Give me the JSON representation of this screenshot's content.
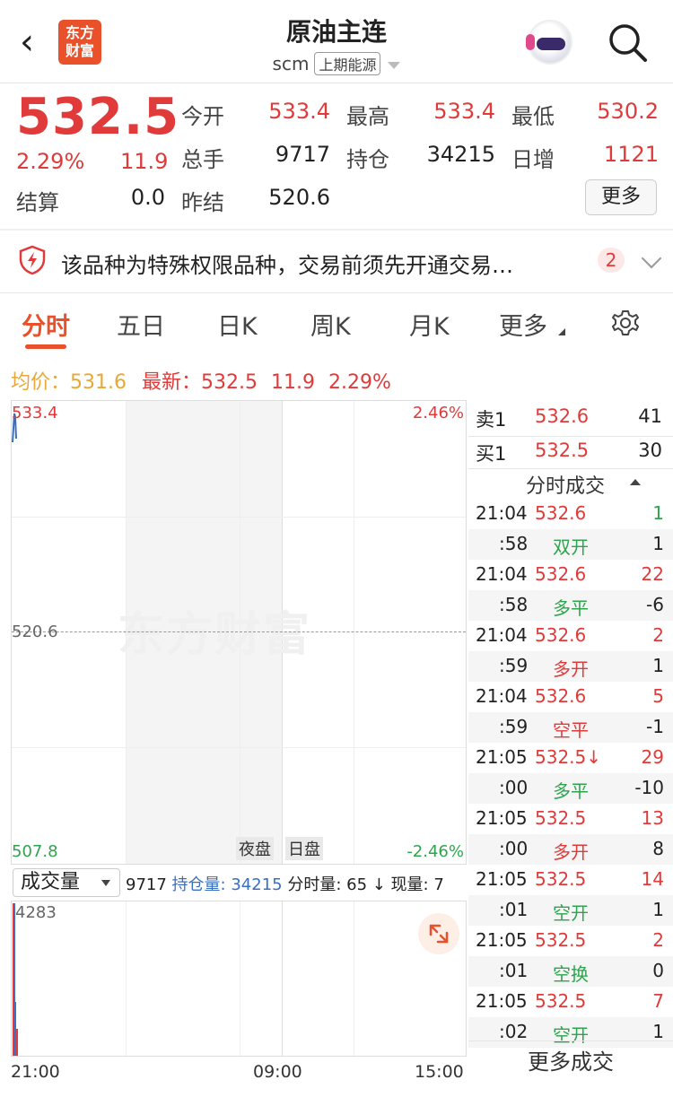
{
  "header": {
    "title": "原油主连",
    "code": "scm",
    "exchange": "上期能源",
    "logo_line1": "东方",
    "logo_line2": "财富"
  },
  "quote": {
    "price": "532.5",
    "change_pct": "2.29%",
    "change": "11.9",
    "open_label": "今开",
    "open": "533.4",
    "high_label": "最高",
    "high": "533.4",
    "low_label": "最低",
    "low": "530.2",
    "volume_label": "总手",
    "volume": "9717",
    "oi_label": "持仓",
    "oi": "34215",
    "daily_inc_label": "日增",
    "daily_inc": "1121",
    "settle_label": "结算",
    "settle": "0.0",
    "prev_settle_label": "昨结",
    "prev_settle": "520.6",
    "more_label": "更多"
  },
  "notice": {
    "text": "该品种为特殊权限品种，交易前须先开通交易…",
    "count": "2"
  },
  "tabs": [
    "分时",
    "五日",
    "日K",
    "周K",
    "月K",
    "更多"
  ],
  "info": {
    "avg_label": "均价：",
    "avg": "531.6",
    "latest_label": "最新：",
    "latest": "532.5",
    "change": "11.9",
    "pct": "2.29%"
  },
  "chart": {
    "y_top": "533.4",
    "y_mid": "520.6",
    "y_bottom": "507.8",
    "pct_top": "2.46%",
    "pct_bottom": "-2.46%",
    "watermark": "东方财富",
    "night_label": "夜盘",
    "day_label": "日盘"
  },
  "volume": {
    "selector": "成交量",
    "total": "9717",
    "oi_label": "持仓量: ",
    "oi": "34215",
    "tick_label": "分时量: 65 ↓ 现量: 7",
    "max": "4283"
  },
  "x_axis": [
    "21:00",
    "09:00",
    "15:00"
  ],
  "orderbook": {
    "ask_label": "卖1",
    "ask_price": "532.6",
    "ask_vol": "41",
    "bid_label": "买1",
    "bid_price": "532.5",
    "bid_vol": "30"
  },
  "trades_title": "分时成交",
  "trades": [
    {
      "time": "21:04",
      "price": "532.6",
      "vol": "1",
      "sec": ":58",
      "action": "双开",
      "oi": "1"
    },
    {
      "time": "21:04",
      "price": "532.6",
      "vol": "22",
      "sec": ":58",
      "action": "多平",
      "oi": "-6"
    },
    {
      "time": "21:04",
      "price": "532.6",
      "vol": "2",
      "sec": ":59",
      "action": "多开",
      "oi": "1"
    },
    {
      "time": "21:04",
      "price": "532.6",
      "vol": "5",
      "sec": ":59",
      "action": "空平",
      "oi": "-1"
    },
    {
      "time": "21:05",
      "price": "532.5↓",
      "vol": "29",
      "sec": ":00",
      "action": "多平",
      "oi": "-10"
    },
    {
      "time": "21:05",
      "price": "532.5",
      "vol": "13",
      "sec": ":00",
      "action": "多开",
      "oi": "8"
    },
    {
      "time": "21:05",
      "price": "532.5",
      "vol": "14",
      "sec": ":01",
      "action": "空开",
      "oi": "1"
    },
    {
      "time": "21:05",
      "price": "532.5",
      "vol": "2",
      "sec": ":01",
      "action": "空换",
      "oi": "0"
    },
    {
      "time": "21:05",
      "price": "532.5",
      "vol": "7",
      "sec": ":02",
      "action": "空开",
      "oi": "1"
    }
  ],
  "more_trades_label": "更多成交",
  "colors": {
    "up": "#e03a3a",
    "down": "#2ea44f",
    "brand": "#e8512a",
    "avg": "#e8a838"
  }
}
